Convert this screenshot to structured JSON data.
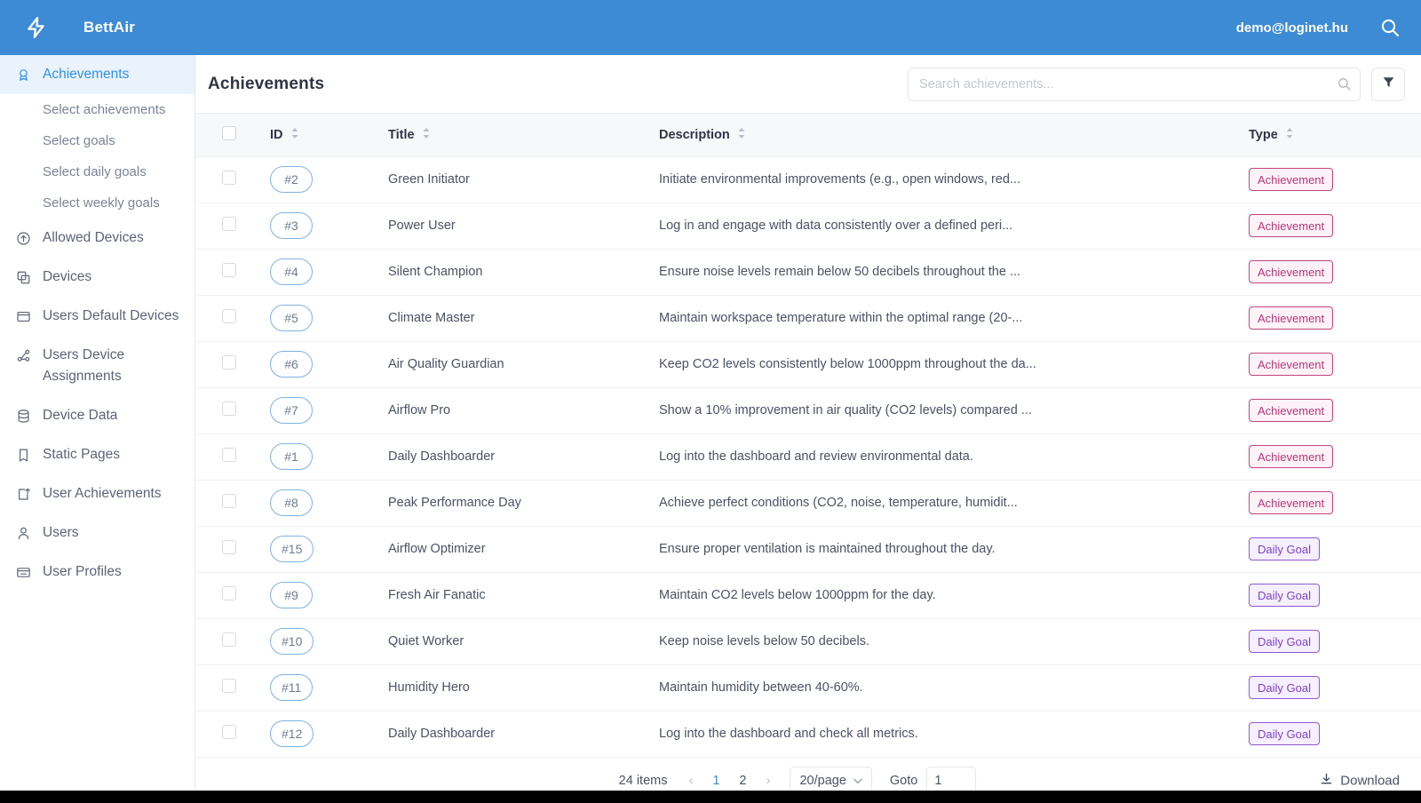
{
  "topbar": {
    "logo_icon": "lightning-bolt-icon",
    "brand": "BettAir",
    "user_email": "demo@loginet.hu",
    "search_icon": "search-icon",
    "bg_color": "#3d8bd4"
  },
  "sidebar": {
    "items": [
      {
        "label": "Achievements",
        "icon": "medal-icon",
        "active": true
      },
      {
        "label": "Allowed Devices",
        "icon": "arrow-up-circle-icon",
        "active": false
      },
      {
        "label": "Devices",
        "icon": "copy-icon",
        "active": false
      },
      {
        "label": "Users Default Devices",
        "icon": "window-icon",
        "active": false
      },
      {
        "label": "Users Device Assignments",
        "icon": "share-nodes-icon",
        "active": false
      },
      {
        "label": "Device Data",
        "icon": "database-icon",
        "active": false
      },
      {
        "label": "Static Pages",
        "icon": "file-icon",
        "active": false
      },
      {
        "label": "User Achievements",
        "icon": "export-icon",
        "active": false
      },
      {
        "label": "Users",
        "icon": "user-icon",
        "active": false
      },
      {
        "label": "User Profiles",
        "icon": "id-card-icon",
        "active": false
      }
    ],
    "subitems": [
      {
        "label": "Select achievements"
      },
      {
        "label": "Select goals"
      },
      {
        "label": "Select daily goals"
      },
      {
        "label": "Select weekly goals"
      }
    ]
  },
  "page": {
    "title": "Achievements",
    "search_placeholder": "Search achievements...",
    "search_value": "",
    "search_icon": "search-icon",
    "filter_icon": "funnel-icon"
  },
  "table": {
    "columns": [
      {
        "key": "checkbox",
        "label": ""
      },
      {
        "key": "id",
        "label": "ID"
      },
      {
        "key": "title",
        "label": "Title"
      },
      {
        "key": "description",
        "label": "Description"
      },
      {
        "key": "type",
        "label": "Type"
      }
    ],
    "rows": [
      {
        "id": "#2",
        "title": "Green Initiator",
        "description": "Initiate environmental improvements (e.g., open windows, red...",
        "type": "Achievement",
        "type_class": "achievement"
      },
      {
        "id": "#3",
        "title": "Power User",
        "description": "Log in and engage with data consistently over a defined peri...",
        "type": "Achievement",
        "type_class": "achievement"
      },
      {
        "id": "#4",
        "title": "Silent Champion",
        "description": "Ensure noise levels remain below 50 decibels throughout the ...",
        "type": "Achievement",
        "type_class": "achievement"
      },
      {
        "id": "#5",
        "title": "Climate Master",
        "description": "Maintain workspace temperature within the optimal range (20-...",
        "type": "Achievement",
        "type_class": "achievement"
      },
      {
        "id": "#6",
        "title": "Air Quality Guardian",
        "description": "Keep CO2 levels consistently below 1000ppm throughout the da...",
        "type": "Achievement",
        "type_class": "achievement"
      },
      {
        "id": "#7",
        "title": "Airflow Pro",
        "description": "Show a 10% improvement in air quality (CO2 levels) compared ...",
        "type": "Achievement",
        "type_class": "achievement"
      },
      {
        "id": "#1",
        "title": "Daily Dashboarder",
        "description": "Log into the dashboard and review environmental data.",
        "type": "Achievement",
        "type_class": "achievement"
      },
      {
        "id": "#8",
        "title": "Peak Performance Day",
        "description": "Achieve perfect conditions (CO2, noise, temperature, humidit...",
        "type": "Achievement",
        "type_class": "achievement"
      },
      {
        "id": "#15",
        "title": "Airflow Optimizer",
        "description": "Ensure proper ventilation is maintained throughout the day.",
        "type": "Daily Goal",
        "type_class": "daily"
      },
      {
        "id": "#9",
        "title": "Fresh Air Fanatic",
        "description": "Maintain CO2 levels below 1000ppm for the day.",
        "type": "Daily Goal",
        "type_class": "daily"
      },
      {
        "id": "#10",
        "title": "Quiet Worker",
        "description": "Keep noise levels below 50 decibels.",
        "type": "Daily Goal",
        "type_class": "daily"
      },
      {
        "id": "#11",
        "title": "Humidity Hero",
        "description": "Maintain humidity between 40-60%.",
        "type": "Daily Goal",
        "type_class": "daily"
      },
      {
        "id": "#12",
        "title": "Daily Dashboarder",
        "description": "Log into the dashboard and check all metrics.",
        "type": "Daily Goal",
        "type_class": "daily"
      }
    ]
  },
  "footer": {
    "total_items": "24 items",
    "prev_arrow": "‹",
    "next_arrow": "›",
    "pages": [
      "1",
      "2"
    ],
    "active_page": "1",
    "page_size": "20/page",
    "goto_label": "Goto",
    "goto_value": "1",
    "download_label": "Download",
    "download_icon": "download-icon"
  },
  "colors": {
    "brand_blue": "#3d8bd4",
    "active_nav_bg": "#eaf3fb",
    "active_nav_text": "#2f90e8",
    "achievement_border": "#c1457f",
    "daily_border": "#9157d0",
    "id_pill_border": "#7fb2e3"
  }
}
